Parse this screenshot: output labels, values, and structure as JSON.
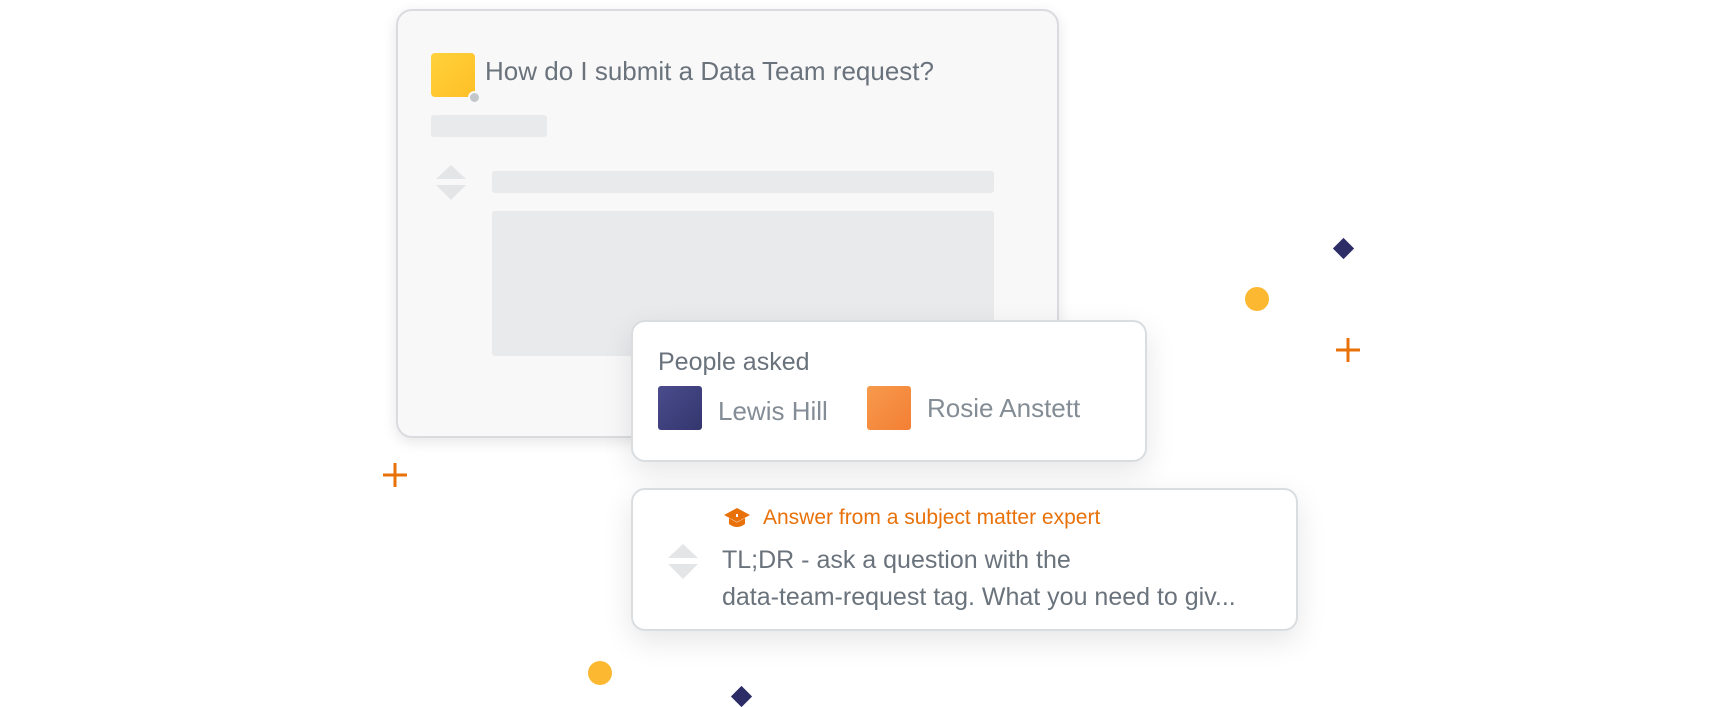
{
  "question": {
    "title": "How do I submit a Data Team request?",
    "avatar_color": "#ffc832"
  },
  "people_asked": {
    "label": "People asked",
    "people": [
      {
        "name": "Lewis Hill",
        "avatar_color": "#3d3f7e"
      },
      {
        "name": "Rosie Anstett",
        "avatar_color": "#f58a3c"
      }
    ]
  },
  "answer": {
    "expert_label": "Answer from a subject matter expert",
    "expert_icon": "graduation-cap-icon",
    "text_lines": [
      "TL;DR - ask a question with the",
      "data-team-request tag. What you need to giv..."
    ]
  },
  "colors": {
    "accent_orange": "#e8710a",
    "dot_yellow": "#fcb831",
    "diamond_navy": "#2c2c66",
    "text_gray": "#6a737c"
  }
}
